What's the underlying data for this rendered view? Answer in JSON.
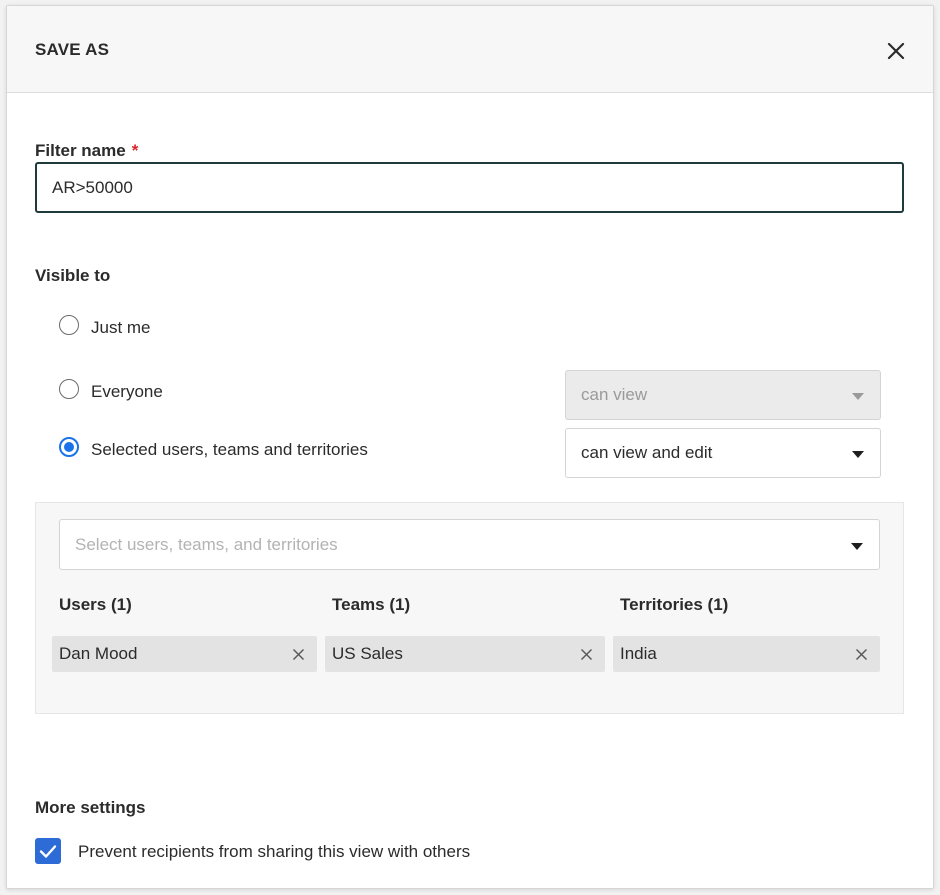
{
  "dialog": {
    "title": "SAVE AS",
    "close_icon": "close-icon"
  },
  "filter_name": {
    "label": "Filter name",
    "required_mark": "*",
    "value": "AR>50000"
  },
  "visible_to": {
    "label": "Visible to",
    "options": [
      {
        "label": "Just me",
        "selected": false
      },
      {
        "label": "Everyone",
        "selected": false
      },
      {
        "label": "Selected users, teams and territories",
        "selected": true
      }
    ],
    "everyone_permission": {
      "value": "can view",
      "disabled": true
    },
    "selected_permission": {
      "value": "can view and edit",
      "disabled": false
    }
  },
  "share_panel": {
    "picker_placeholder": "Select users, teams, and territories",
    "columns": [
      {
        "heading": "Users (1)",
        "items": [
          "Dan Mood"
        ]
      },
      {
        "heading": "Teams (1)",
        "items": [
          "US Sales"
        ]
      },
      {
        "heading": "Territories (1)",
        "items": [
          "India"
        ]
      }
    ],
    "remove_icon": "close-icon"
  },
  "more_settings": {
    "label": "More settings",
    "prevent_sharing": {
      "label": "Prevent recipients from sharing this view with others",
      "checked": true
    }
  },
  "colors": {
    "accent_blue": "#1a73e8",
    "checkbox_blue": "#2d6bd6",
    "required_red": "#d9262b"
  }
}
